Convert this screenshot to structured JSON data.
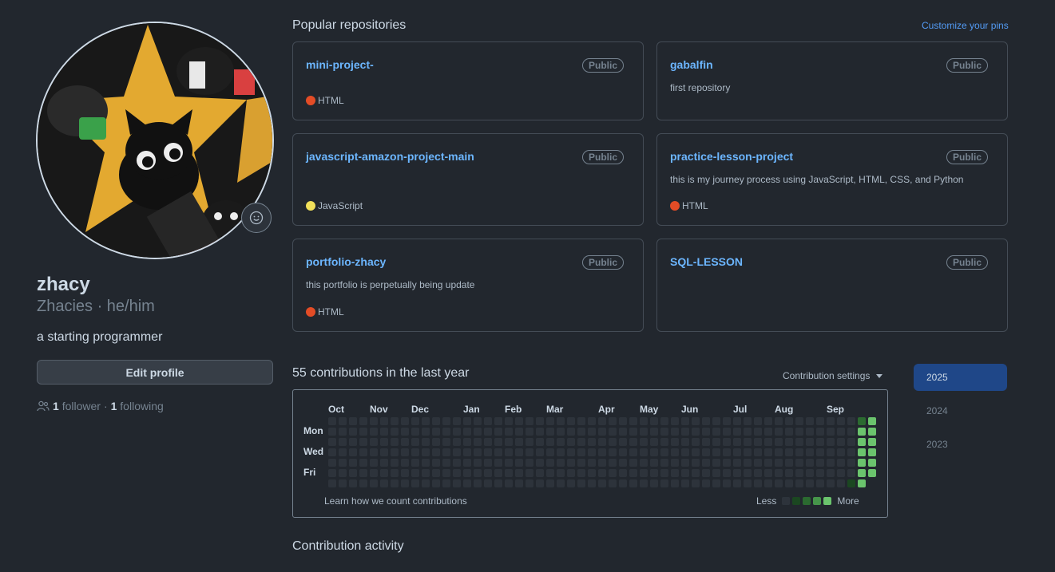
{
  "profile": {
    "name": "zhacy",
    "subtitle": "Zhacies · he/him",
    "bio": "a starting programmer",
    "edit_label": "Edit profile",
    "followers_count": "1",
    "followers_label": "follower",
    "separator": "·",
    "following_count": "1",
    "following_label": "following",
    "avatar_icon": "cat-avatar-image",
    "status_icon": "smiley-icon"
  },
  "popular": {
    "title": "Popular repositories",
    "customize_label": "Customize your pins",
    "repos": [
      {
        "name": "mini-project-",
        "badge": "Public",
        "description": "",
        "language": "HTML",
        "lang_color": "#e34c26"
      },
      {
        "name": "gabalfin",
        "badge": "Public",
        "description": "first repository",
        "language": "",
        "lang_color": ""
      },
      {
        "name": "javascript-amazon-project-main",
        "badge": "Public",
        "description": "",
        "language": "JavaScript",
        "lang_color": "#f1e05a"
      },
      {
        "name": "practice-lesson-project",
        "badge": "Public",
        "description": "this is my journey process using JavaScript, HTML, CSS, and Python",
        "language": "HTML",
        "lang_color": "#e34c26"
      },
      {
        "name": "portfolio-zhacy",
        "badge": "Public",
        "description": "this portfolio is perpetually being update",
        "language": "HTML",
        "lang_color": "#e34c26"
      },
      {
        "name": "SQL-LESSON",
        "badge": "Public",
        "description": "",
        "language": "",
        "lang_color": ""
      }
    ]
  },
  "contributions": {
    "title": "55 contributions in the last year",
    "settings_label": "Contribution settings",
    "months": [
      "Oct",
      "Nov",
      "Dec",
      "Jan",
      "Feb",
      "Mar",
      "Apr",
      "May",
      "Jun",
      "Jul",
      "Aug",
      "Sep"
    ],
    "days": [
      "Mon",
      "Wed",
      "Fri"
    ],
    "learn_label": "Learn how we count contributions",
    "less_label": "Less",
    "more_label": "More",
    "colors": {
      "empty": "#2d333b",
      "l1": "#1b4721",
      "l2": "#2b6a30",
      "l3": "#46954a",
      "l4": "#6bc46d"
    },
    "recent_week_levels": [
      [
        0,
        0,
        0,
        0,
        0,
        0,
        1
      ],
      [
        2,
        4,
        4,
        4,
        4,
        4,
        4
      ],
      [
        4,
        4,
        4,
        4,
        4,
        4,
        -1
      ]
    ]
  },
  "years": [
    "2025",
    "2024",
    "2023"
  ],
  "activity": {
    "title": "Contribution activity"
  }
}
